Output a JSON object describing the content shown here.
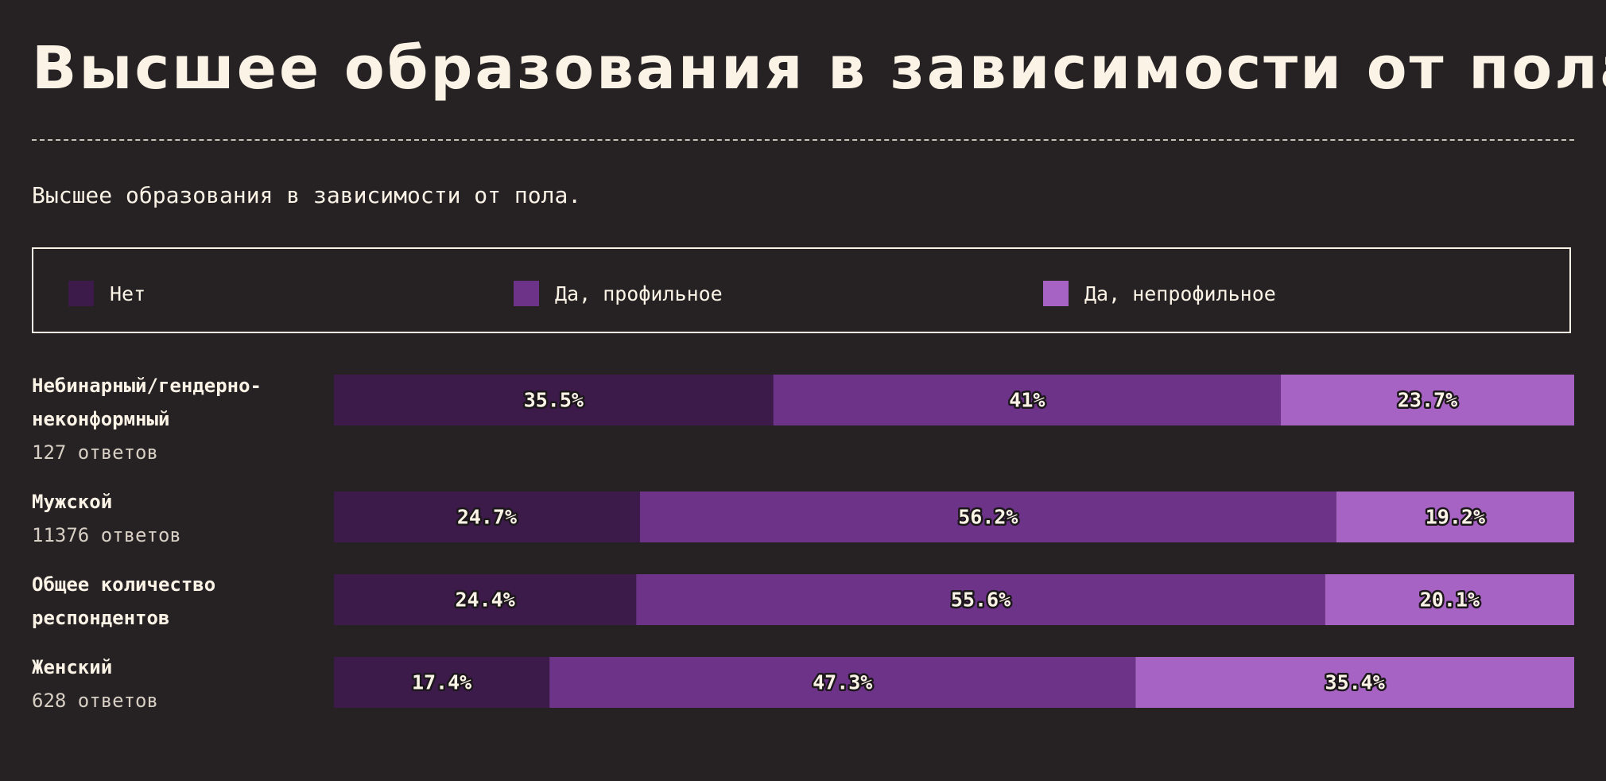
{
  "title": "Высшее образования в зависимости от пола",
  "subtitle": "Высшее образования в зависимости от пола.",
  "legend": [
    {
      "label": "Нет",
      "color": "#3c1a4a"
    },
    {
      "label": "Да, профильное",
      "color": "#6c3388"
    },
    {
      "label": "Да, непрофильное",
      "color": "#a763c4"
    }
  ],
  "rows": [
    {
      "name_lines": [
        "Небинарный/гендерно-",
        "неконформный"
      ],
      "count": "127 ответов"
    },
    {
      "name_lines": [
        "Мужской"
      ],
      "count": "11376 ответов"
    },
    {
      "name_lines": [
        "Общее количество",
        "респондентов"
      ],
      "count": ""
    },
    {
      "name_lines": [
        "Женский"
      ],
      "count": "628 ответов"
    }
  ],
  "chart_data": {
    "type": "bar",
    "orientation": "horizontal",
    "stacked": true,
    "normalized": true,
    "categories": [
      "Небинарный/гендерно-неконформный",
      "Мужской",
      "Общее количество респондентов",
      "Женский"
    ],
    "series": [
      {
        "name": "Нет",
        "color": "#3c1a4a",
        "values": [
          35.5,
          24.7,
          24.4,
          17.4
        ],
        "labels": [
          "35.5%",
          "24.7%",
          "24.4%",
          "17.4%"
        ]
      },
      {
        "name": "Да, профильное",
        "color": "#6c3388",
        "values": [
          41,
          56.2,
          55.6,
          47.3
        ],
        "labels": [
          "41%",
          "56.2%",
          "55.6%",
          "47.3%"
        ]
      },
      {
        "name": "Да, непрофильное",
        "color": "#a763c4",
        "values": [
          23.7,
          19.2,
          20.1,
          35.4
        ],
        "labels": [
          "23.7%",
          "19.2%",
          "20.1%",
          "35.4%"
        ]
      }
    ],
    "xlim": [
      0,
      100
    ],
    "legend_position": "top",
    "grid": false
  }
}
